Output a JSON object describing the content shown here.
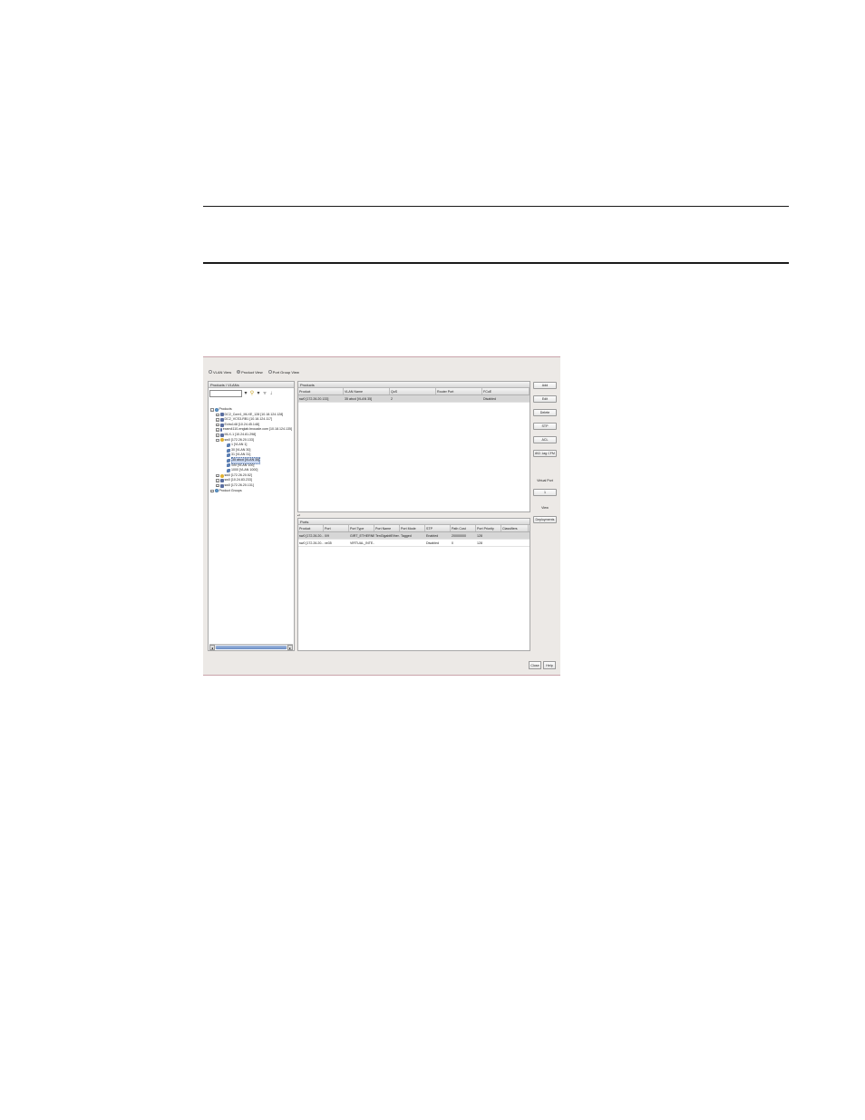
{
  "views": {
    "vlan_view": "VLAN View",
    "product_view": "Product View",
    "port_group_view": "Port Group View",
    "selected": "product_view"
  },
  "left_panel": {
    "title": "Products / VLANs",
    "tree": [
      {
        "label": "Products",
        "icon": "globe-icon"
      },
      {
        "label": "DC2_Core1_MLXE_128 [10.18.124.128]",
        "icon": "switch-icon"
      },
      {
        "label": "DC2_VCS3-RB1 [10.18.124.117]",
        "icon": "switch-icon"
      },
      {
        "label": "Extro148 [10.24.45.148]",
        "icon": "switch-icon"
      },
      {
        "label": "exam4110-englab.brocade.com [10.18.124.135]",
        "icon": "switch-icon"
      },
      {
        "label": "MLX-1 [10.24.81.298]",
        "icon": "switch-icon"
      },
      {
        "label": "sw0 [172.26.20.133]",
        "icon": "switch-icon"
      },
      {
        "label": "1 [VLAN 1]",
        "icon": "vlan-icon"
      },
      {
        "label": "30 [VLAN 30]",
        "icon": "vlan-icon"
      },
      {
        "label": "31 [VLAN 31]",
        "icon": "vlan-icon"
      },
      {
        "label": "35 abcd [VLAN 35]",
        "icon": "vlan-icon"
      },
      {
        "label": "100 [VLAN 100]",
        "icon": "vlan-icon"
      },
      {
        "label": "1000 [VLAN 1000]",
        "icon": "vlan-icon"
      },
      {
        "label": "sw0 [172.26.20.52]",
        "icon": "switch-icon"
      },
      {
        "label": "sw0 [10.24.83.233]",
        "icon": "switch-icon"
      },
      {
        "label": "sw0 [172.26.20.131]",
        "icon": "switch-icon"
      },
      {
        "label": "Product Groups",
        "icon": "globe-icon"
      }
    ]
  },
  "products_table": {
    "title": "Products",
    "columns": [
      "Product",
      "VLAN Name",
      "QoS",
      "Router Port",
      "FCoE"
    ],
    "rows": [
      [
        "sw0 [172.26.20.133]",
        "35 abcd [VLAN 35]",
        "2",
        "",
        "Disabled"
      ]
    ]
  },
  "ports_table": {
    "title": "Ports",
    "columns": [
      "Product",
      "Port",
      "Port Type",
      "Port Name",
      "Port Mode",
      "STP",
      "Path Cost",
      "Port Priority",
      "Classifiers"
    ],
    "rows": [
      [
        "sw0 [172.26.20...",
        "0/9",
        "GIRT_ETHERNE...",
        "TenGigabitEther...",
        "Tagged",
        "Enabled",
        "20000000",
        "128",
        ""
      ],
      [
        "sw0 [172.26.20...",
        "ve35",
        "VIRTUAL_INTE...",
        "",
        "",
        "Disabled",
        "0",
        "128",
        ""
      ]
    ]
  },
  "side_buttons": {
    "add": "Add",
    "edit": "Edit",
    "delete": "Delete",
    "stp": "STP",
    "acl": "ACL",
    "stp_8021q": "802.1ag CFM",
    "virtual_port_label": "Virtual Port",
    "virtual_port_value": "1",
    "view_label": "View",
    "deployments": "Deployments"
  },
  "footer": {
    "close": "Close",
    "help": "Help"
  }
}
